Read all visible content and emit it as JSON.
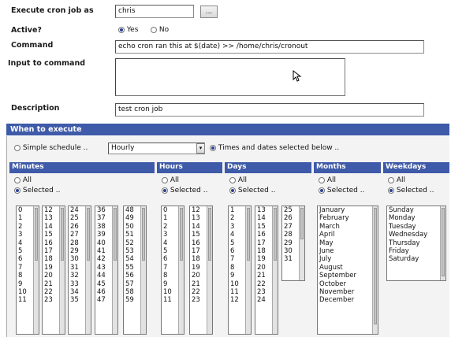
{
  "form": {
    "run_as_label": "Execute cron job as",
    "run_as_value": "chris",
    "run_as_button": "...",
    "active_label": "Active?",
    "active_yes": "Yes",
    "active_no": "No",
    "command_label": "Command",
    "command_value": "echo cron ran this at $(date) >> /home/chris/cronout",
    "input_label": "Input to command",
    "description_label": "Description",
    "description_value": "test cron job"
  },
  "when": {
    "title": "When to execute",
    "simple_label": "Simple schedule ..",
    "simple_value": "Hourly",
    "times_label": "Times and dates selected below .."
  },
  "columns": {
    "minutes": {
      "title": "Minutes",
      "all": "All",
      "selected": "Selected .."
    },
    "hours": {
      "title": "Hours",
      "all": "All",
      "selected": "Selected .."
    },
    "days": {
      "title": "Days",
      "all": "All",
      "selected": "Selected .."
    },
    "months": {
      "title": "Months",
      "all": "All",
      "selected": "Selected .."
    },
    "weekdays": {
      "title": "Weekdays",
      "all": "All",
      "selected": "Selected .."
    }
  },
  "lists": {
    "minutes": [
      [
        "0",
        "1",
        "2",
        "3",
        "4",
        "5",
        "6",
        "7",
        "8",
        "9",
        "10",
        "11"
      ],
      [
        "12",
        "13",
        "14",
        "15",
        "16",
        "17",
        "18",
        "19",
        "20",
        "21",
        "22",
        "23"
      ],
      [
        "24",
        "25",
        "26",
        "27",
        "28",
        "29",
        "30",
        "31",
        "32",
        "33",
        "34",
        "35"
      ],
      [
        "36",
        "37",
        "38",
        "39",
        "40",
        "41",
        "42",
        "43",
        "44",
        "45",
        "46",
        "47"
      ],
      [
        "48",
        "49",
        "50",
        "51",
        "52",
        "53",
        "54",
        "55",
        "56",
        "57",
        "58",
        "59"
      ]
    ],
    "hours": [
      [
        "0",
        "1",
        "2",
        "3",
        "4",
        "5",
        "6",
        "7",
        "8",
        "9",
        "10",
        "11"
      ],
      [
        "12",
        "13",
        "14",
        "15",
        "16",
        "17",
        "18",
        "19",
        "20",
        "21",
        "22",
        "23"
      ]
    ],
    "days": [
      [
        "1",
        "2",
        "3",
        "4",
        "5",
        "6",
        "7",
        "8",
        "9",
        "10",
        "11",
        "12"
      ],
      [
        "13",
        "14",
        "15",
        "16",
        "17",
        "18",
        "19",
        "20",
        "21",
        "22",
        "23",
        "24"
      ],
      [
        "25",
        "26",
        "27",
        "28",
        "29",
        "30",
        "31"
      ]
    ],
    "months": [
      "January",
      "February",
      "March",
      "April",
      "May",
      "June",
      "July",
      "August",
      "September",
      "October",
      "November",
      "December"
    ],
    "weekdays": [
      "Sunday",
      "Monday",
      "Tuesday",
      "Wednesday",
      "Thursday",
      "Friday",
      "Saturday"
    ]
  }
}
